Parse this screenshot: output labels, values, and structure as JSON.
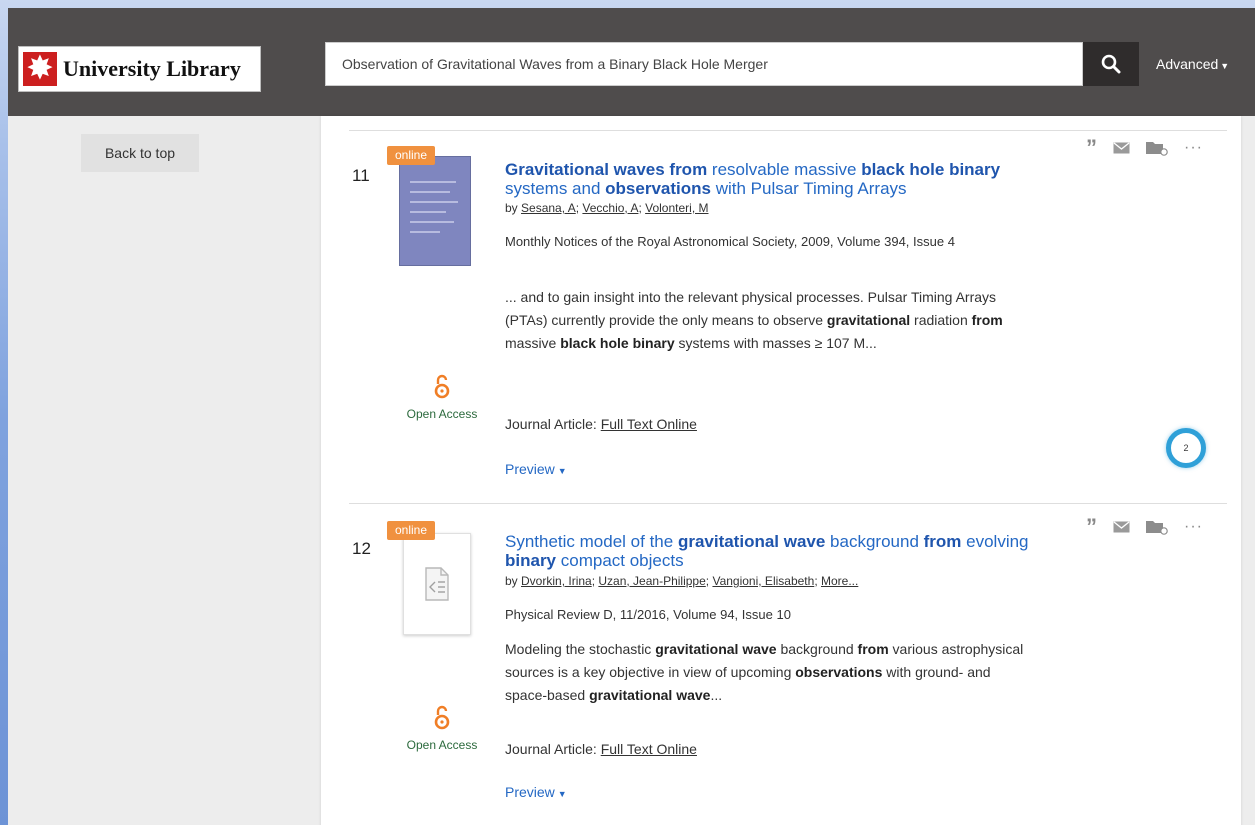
{
  "header": {
    "logo_text": "University Library",
    "search_value": "Observation of Gravitational Waves from a Binary Black Hole Merger",
    "advanced_label": "Advanced",
    "search_icon": "search-icon"
  },
  "sidebar": {
    "back_to_top": "Back to top"
  },
  "results": [
    {
      "number": "11",
      "badge": "online",
      "title_parts": [
        {
          "t": "Gravitational waves from",
          "b": true
        },
        {
          "t": " resolvable massive ",
          "b": false
        },
        {
          "t": "black hole binary",
          "b": true
        },
        {
          "t": " systems and ",
          "b": false
        },
        {
          "t": "observations",
          "b": true
        },
        {
          "t": " with Pulsar Timing Arrays",
          "b": false
        }
      ],
      "authors_prefix": "by ",
      "authors": [
        "Sesana, A",
        "Vecchio, A",
        "Volonteri, M"
      ],
      "source": "Monthly Notices of the Royal Astronomical Society, 2009, Volume 394, Issue 4",
      "snippet_parts": [
        {
          "t": "... and to gain insight into the relevant physical processes. Pulsar Timing Arrays (PTAs) currently provide the only means to observe ",
          "b": false
        },
        {
          "t": "gravitational",
          "b": true
        },
        {
          "t": " radiation ",
          "b": false
        },
        {
          "t": "from",
          "b": true
        },
        {
          "t": " massive ",
          "b": false
        },
        {
          "t": "black hole binary",
          "b": true
        },
        {
          "t": " systems with masses ≥ 107 M...",
          "b": false
        }
      ],
      "open_access": "Open Access",
      "format_type": "Journal Article: ",
      "format_link": "Full Text Online",
      "preview": "Preview",
      "altmetric": "2"
    },
    {
      "number": "12",
      "badge": "online",
      "title_parts": [
        {
          "t": "Synthetic model of the ",
          "b": false
        },
        {
          "t": "gravitational wave",
          "b": true
        },
        {
          "t": " background ",
          "b": false
        },
        {
          "t": "from",
          "b": true
        },
        {
          "t": " evolving ",
          "b": false
        },
        {
          "t": "binary",
          "b": true
        },
        {
          "t": " compact objects",
          "b": false
        }
      ],
      "authors_prefix": "by ",
      "authors": [
        "Dvorkin, Irina",
        "Uzan, Jean-Philippe",
        "Vangioni, Elisabeth",
        "More..."
      ],
      "source": "Physical Review D, 11/2016, Volume 94, Issue 10",
      "snippet_parts": [
        {
          "t": "Modeling the stochastic ",
          "b": false
        },
        {
          "t": "gravitational wave",
          "b": true
        },
        {
          "t": " background ",
          "b": false
        },
        {
          "t": "from",
          "b": true
        },
        {
          "t": " various astrophysical sources is a key objective in view of upcoming ",
          "b": false
        },
        {
          "t": "observations",
          "b": true
        },
        {
          "t": " with ground- and space-based ",
          "b": false
        },
        {
          "t": "gravitational wave",
          "b": true
        },
        {
          "t": "...",
          "b": false
        }
      ],
      "open_access": "Open Access",
      "format_type": "Journal Article: ",
      "format_link": "Full Text Online",
      "preview": "Preview"
    }
  ],
  "action_icons": [
    "cite-icon",
    "email-icon",
    "folder-icon",
    "more-icon"
  ]
}
